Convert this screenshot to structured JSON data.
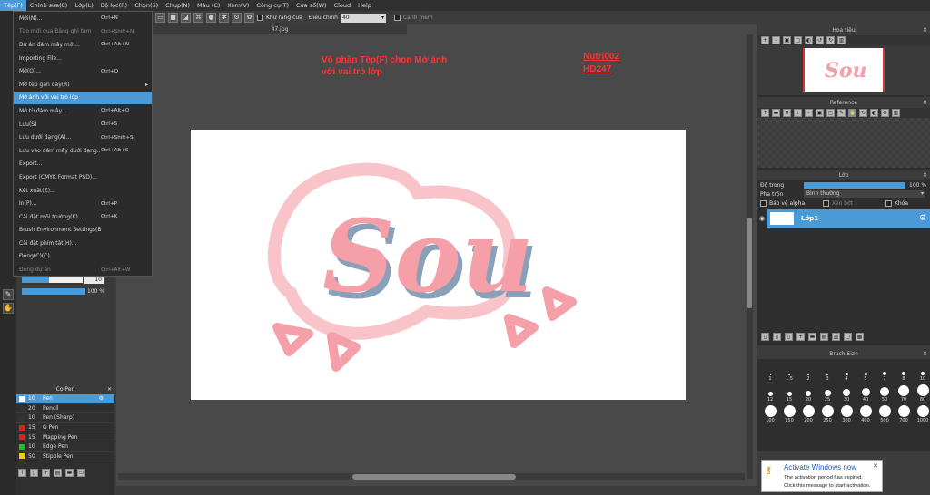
{
  "menubar": [
    "Tệp(F)",
    "Chỉnh sửa(E)",
    "Lớp(L)",
    "Bộ lọc(R)",
    "Chọn(S)",
    "Chụp(N)",
    "Màu (C)",
    "Xem(V)",
    "Công cụ(T)",
    "Cửa sổ(W)",
    "Cloud",
    "Help"
  ],
  "toolbar": {
    "antialias_label": "Khử răng cưa",
    "adjust_label": "Điều chỉnh",
    "adjust_value": "40",
    "edge_label": "Cạnh mềm"
  },
  "file_menu": [
    {
      "label": "Mới(N)...",
      "shortcut": "Ctrl+N"
    },
    {
      "label": "Tạo mới qua Bảng ghi tạm",
      "shortcut": "Ctrl+Shift+N",
      "dim": true
    },
    {
      "label": "Dự án đám mây mới...",
      "shortcut": "Ctrl+Alt+N"
    },
    {
      "label": "Importing File...",
      "shortcut": ""
    },
    {
      "label": "Mở(O)...",
      "shortcut": "Ctrl+O"
    },
    {
      "label": "Mở tệp gần đây(R)",
      "shortcut": "",
      "submenu": true
    },
    {
      "label": "Mở ảnh với vai trò lớp",
      "shortcut": "",
      "highlight": true
    },
    {
      "label": "Mở từ đám mây...",
      "shortcut": "Ctrl+Alt+O"
    },
    {
      "label": "Lưu(S)",
      "shortcut": "Ctrl+S"
    },
    {
      "label": "Lưu dưới dạng(A)...",
      "shortcut": "Ctrl+Shift+S"
    },
    {
      "label": "Lưu vào đám mây dưới dạng...",
      "shortcut": "Ctrl+Alt+S"
    },
    {
      "label": "Export...",
      "shortcut": ""
    },
    {
      "label": "Export (CMYK Format PSD)...",
      "shortcut": ""
    },
    {
      "label": "Kết xuất(Z)...",
      "shortcut": ""
    },
    {
      "label": "In(P)...",
      "shortcut": "Ctrl+P"
    },
    {
      "label": "Cài đặt môi trường(K)...",
      "shortcut": "Ctrl+K"
    },
    {
      "label": "Brush Environment Settings(B)...",
      "shortcut": ""
    },
    {
      "label": "Cài đặt phím tắt(H)...",
      "shortcut": ""
    },
    {
      "label": "Đóng(C)(C)",
      "shortcut": ""
    },
    {
      "label": "Đóng dự án",
      "shortcut": "Ctrl+Alt+W",
      "dim": true
    }
  ],
  "document": {
    "tab_title": "47.jpg",
    "note_left": "Vô phần Tệp(F) chọn Mở ảnh với vai trò lớp",
    "note_right_1": "Nutri002",
    "note_right_2": "HD247",
    "artwork_text": "Sou"
  },
  "left_panel": {
    "size_value": "10",
    "opacity_value": "100 %",
    "size_level": 0.45,
    "opacity_level": 1.0
  },
  "pen_panel": {
    "title": "Cọ Pen",
    "items": [
      {
        "size": "10",
        "name": "Pen",
        "color": "#ffffff",
        "selected": true
      },
      {
        "size": "20",
        "name": "Pencil",
        "color": "#333333"
      },
      {
        "size": "10",
        "name": "Pen (Sharp)",
        "color": "#333333"
      },
      {
        "size": "15",
        "name": "G Pen",
        "color": "#e02020"
      },
      {
        "size": "15",
        "name": "Mapping Pen",
        "color": "#e02020"
      },
      {
        "size": "10",
        "name": "Edge Pen",
        "color": "#20c020"
      },
      {
        "size": "50",
        "name": "Stipple Pen",
        "color": "#f0d000"
      }
    ]
  },
  "navigator": {
    "title": "Hoa tiêu"
  },
  "reference": {
    "title": "Reference"
  },
  "layers": {
    "title": "Lớp",
    "opacity_label": "Độ trong",
    "opacity_value": "100 %",
    "blend_label": "Pha trộn",
    "blend_value": "Bình thường",
    "protect_alpha": "Bảo vệ alpha",
    "clipping": "Xén bớt",
    "lock": "Khóa",
    "layer_name": "Lớp1"
  },
  "brush_size": {
    "title": "Brush Size",
    "sizes": [
      "1",
      "1.5",
      "2",
      "3",
      "4",
      "5",
      "7",
      "8",
      "10",
      "12",
      "15",
      "20",
      "25",
      "30",
      "40",
      "50",
      "70",
      "80",
      "100",
      "150",
      "200",
      "250",
      "300",
      "400",
      "500",
      "700",
      "1000"
    ]
  },
  "activation": {
    "title": "Activate Windows now",
    "line1": "The activation period has expired.",
    "line2": "Click this message to start activation."
  },
  "colors": {
    "accent": "#4a9ad8",
    "note": "#ff3333",
    "art_pink": "#f5a0a8"
  }
}
